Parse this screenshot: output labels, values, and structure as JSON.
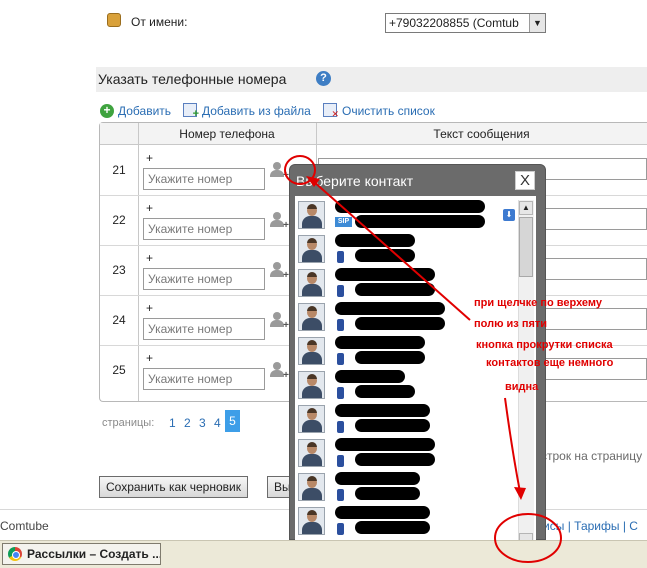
{
  "sender": {
    "label": "От имени:",
    "value": "+79032208855 (Comtub"
  },
  "section": {
    "title": "Указать телефонные номера",
    "help": "?"
  },
  "toolbar": {
    "add": "Добавить",
    "add_from_file": "Добавить из файла",
    "clear": "Очистить список"
  },
  "table": {
    "headers": {
      "phone": "Номер телефона",
      "message": "Текст сообщения"
    },
    "rows": [
      {
        "num": "21",
        "plus": "+",
        "placeholder": "Укажите номер"
      },
      {
        "num": "22",
        "plus": "+",
        "placeholder": "Укажите номер"
      },
      {
        "num": "23",
        "plus": "+",
        "placeholder": "Укажите номер"
      },
      {
        "num": "24",
        "plus": "+",
        "placeholder": "Укажите номер"
      },
      {
        "num": "25",
        "plus": "+",
        "placeholder": "Укажите номер"
      }
    ]
  },
  "pager": {
    "label": "страницы:",
    "pages": [
      "1",
      "2",
      "3",
      "4",
      "5"
    ],
    "active": "5",
    "per_page_fragment": "0 строк на страницу"
  },
  "buttons": {
    "save_draft": "Сохранить как черновик",
    "next_partial": "Вы"
  },
  "footer": {
    "brand": "Comtube",
    "links": "рвисы | Тарифы | С"
  },
  "taskbar": {
    "window_title": "Рассылки – Создать ..."
  },
  "popup": {
    "title": "Выберите контакт",
    "close": "X",
    "sip_badge": "SIP",
    "contacts": [
      {
        "type": "sip"
      },
      {
        "type": "mobile"
      },
      {
        "type": "mobile"
      },
      {
        "type": "mobile"
      },
      {
        "type": "mobile"
      },
      {
        "type": "mobile"
      },
      {
        "type": "mobile"
      },
      {
        "type": "mobile"
      },
      {
        "type": "mobile"
      },
      {
        "type": "mobile"
      }
    ]
  },
  "annotation": {
    "lines": [
      "при щелчке по верхему",
      "полю из пяти",
      "кнопка прокрутки списка",
      "контактов еще немного",
      "видна"
    ],
    "color": "#e00000"
  }
}
